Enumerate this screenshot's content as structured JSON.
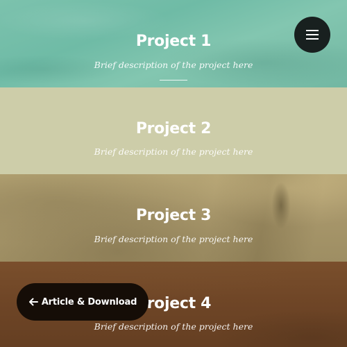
{
  "projects": [
    {
      "title": "Project 1",
      "description": "Brief description of the project here"
    },
    {
      "title": "Project 2",
      "description": "Brief description of the project here"
    },
    {
      "title": "Project 3",
      "description": "Brief description of the project here"
    },
    {
      "title": "Project 4",
      "description": "Brief description of the project here"
    }
  ],
  "menu": {
    "icon": "hamburger-icon"
  },
  "article_button": {
    "label": "Article & Download",
    "icon": "arrow-left-icon"
  },
  "colors": {
    "project1": "#7cc2ad",
    "project2": "#cdcda9",
    "project3": "#a8976b",
    "project4": "#6e4526",
    "menu_button_bg": "#18201f",
    "article_button_bg": "#150d07",
    "text": "#ffffff"
  }
}
